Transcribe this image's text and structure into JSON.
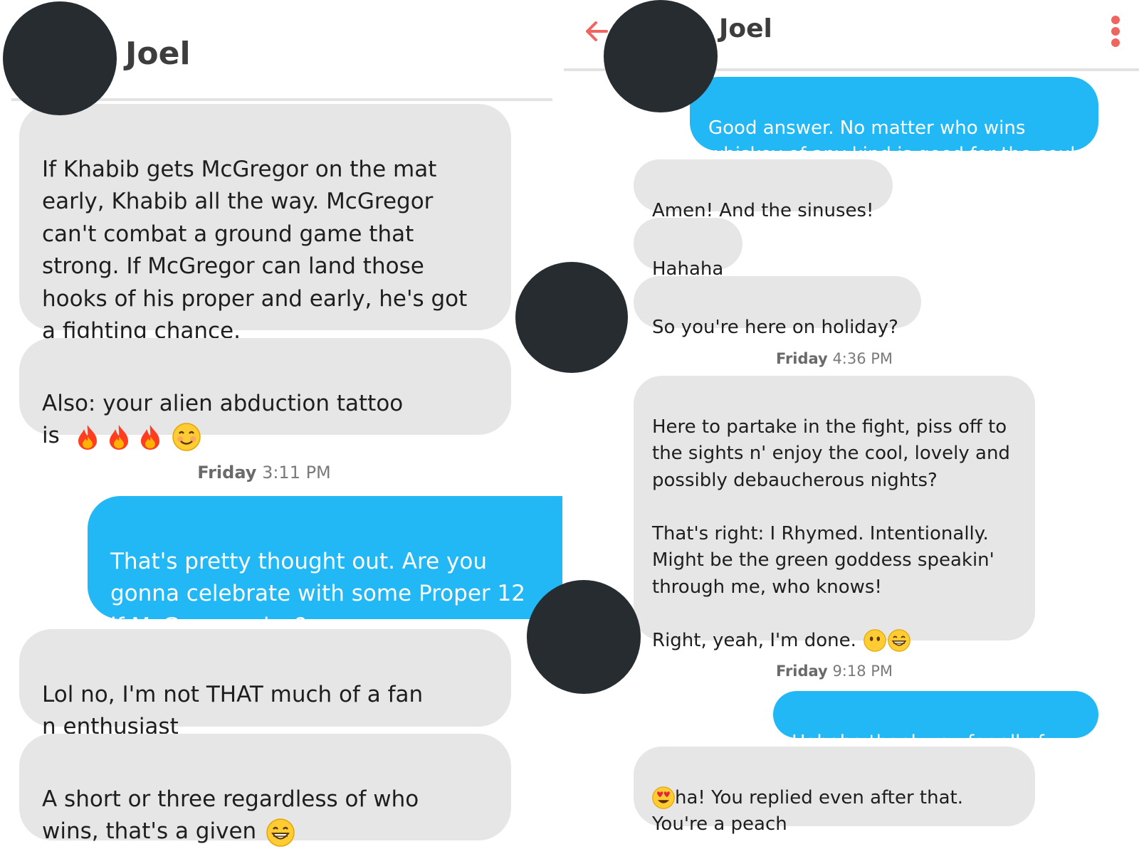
{
  "left": {
    "contact_name": "Joel",
    "messages": [
      {
        "dir": "in",
        "text": "If Khabib gets McGregor on the mat\nearly, Khabib all the way. McGregor\ncan't combat a ground game that\nstrong. If McGregor can land those\nhooks of his proper and early, he's got\na fighting chance."
      },
      {
        "dir": "in",
        "text": "Also: your alien abduction tattoo\nis ",
        "emojis": [
          "fire",
          "fire",
          "fire",
          "smiling-face"
        ]
      },
      {
        "dir": "out",
        "text": "That's pretty thought out. Are you\ngonna celebrate with some Proper 12\nif McGregor wins?"
      },
      {
        "dir": "in",
        "text": "Lol no, I'm not THAT much of a fan\nn enthusiast"
      },
      {
        "dir": "in",
        "text": "A short or three regardless of who\nwins, that's a given ",
        "emojis": [
          "grinning-face"
        ]
      }
    ],
    "timestamp": {
      "day": "Friday",
      "time": "3:11 PM"
    }
  },
  "right": {
    "contact_name": "Joel",
    "messages": [
      {
        "dir": "out",
        "text": "Good answer. No matter who wins\nwhiskey of any kind is good for the soul"
      },
      {
        "dir": "in",
        "text": "Amen! And the sinuses!"
      },
      {
        "dir": "in",
        "text": "Hahaha"
      },
      {
        "dir": "in",
        "text": "So you're here on holiday?"
      },
      {
        "dir": "in",
        "text": "Here to partake in the fight, piss off to\nthe sights n' enjoy the cool, lovely and\npossibly debaucherous nights?\n\nThat's right: I Rhymed. Intentionally.\nMight be the green goddess speakin'\nthrough me, who knows!\n\nRight, yeah, I'm done. ",
        "emojis": [
          "neutral-face",
          "grinning-face"
        ]
      },
      {
        "dir": "out",
        "text": "Hahaha thank you for all of that"
      },
      {
        "dir": "in",
        "text": "ha! You replied even after that.\nYou're a peach",
        "leading_emoji": "heart-eyes-face"
      }
    ],
    "timestamps": [
      {
        "day": "Friday",
        "time": "4:36 PM"
      },
      {
        "day": "Friday",
        "time": "9:18 PM"
      }
    ]
  },
  "colors": {
    "outgoing": "#22b7f5",
    "incoming": "#e6e6e6",
    "accent": "#f0655f",
    "redaction": "#272c31"
  }
}
